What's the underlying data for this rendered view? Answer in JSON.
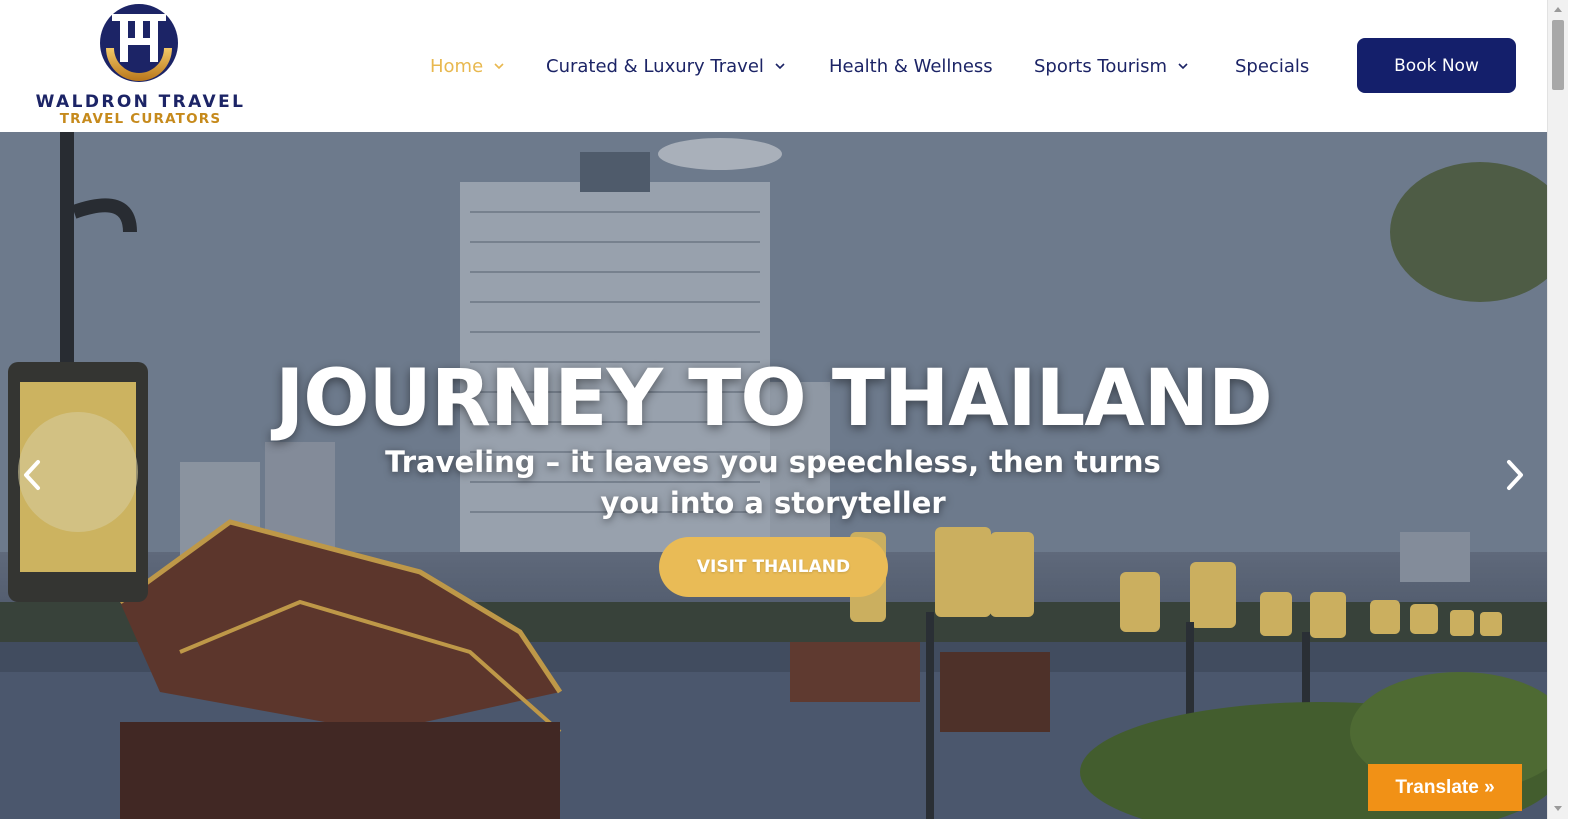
{
  "brand": {
    "name": "WALDRON TRAVEL",
    "tagline": "TRAVEL CURATORS",
    "colors": {
      "navy": "#1c2466",
      "gold": "#e8b84f"
    }
  },
  "nav": {
    "items": [
      {
        "label": "Home",
        "active": true,
        "has_dropdown": true
      },
      {
        "label": "Curated & Luxury Travel",
        "active": false,
        "has_dropdown": true
      },
      {
        "label": "Health & Wellness",
        "active": false,
        "has_dropdown": false
      },
      {
        "label": "Sports Tourism",
        "active": false,
        "has_dropdown": true
      },
      {
        "label": "Specials",
        "active": false,
        "has_dropdown": false
      }
    ],
    "book_now": "Book Now"
  },
  "hero": {
    "title": "JOURNEY TO THAILAND",
    "subtitle": "Traveling – it leaves you speechless, then turns you into a storyteller",
    "cta": "VISIT THAILAND",
    "prev_icon": "chevron-left-icon",
    "next_icon": "chevron-right-icon"
  },
  "translate_widget": {
    "label": "Translate »"
  }
}
